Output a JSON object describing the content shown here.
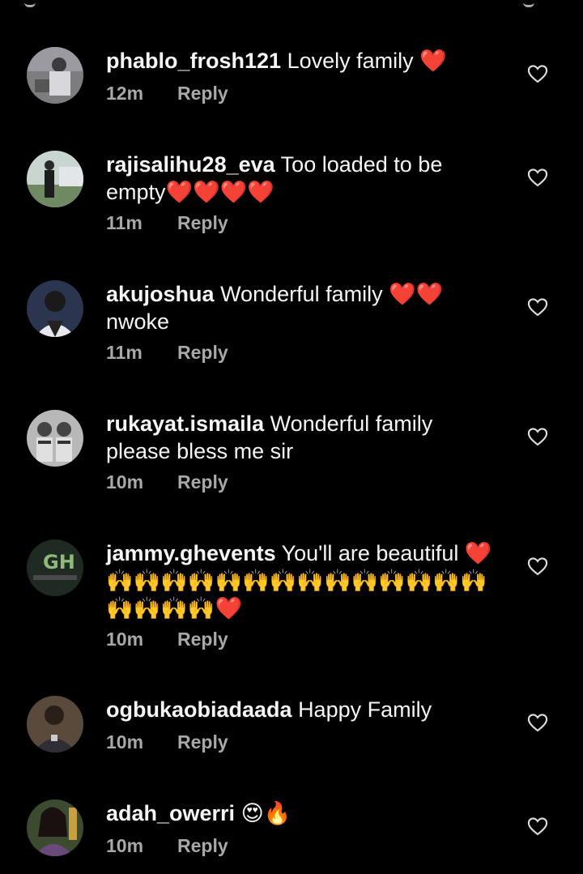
{
  "comments": [
    {
      "username": "phablo_frosh121",
      "text": "Lovely family ❤️",
      "time": "12m",
      "reply": "Reply"
    },
    {
      "username": "rajisalihu28_eva",
      "text": "Too loaded to be empty❤️❤️❤️❤️",
      "time": "11m",
      "reply": "Reply"
    },
    {
      "username": "akujoshua",
      "text": "Wonderful family ❤️❤️ nwoke",
      "time": "11m",
      "reply": "Reply"
    },
    {
      "username": "rukayat.ismaila",
      "text": "Wonderful family please bless me sir",
      "time": "10m",
      "reply": "Reply"
    },
    {
      "username": "jammy.ghevents",
      "text": "You'll are beautiful ❤️ 🙌🙌🙌🙌🙌🙌🙌🙌🙌🙌🙌🙌🙌🙌🙌🙌🙌🙌❤️",
      "time": "10m",
      "reply": "Reply"
    },
    {
      "username": "ogbukaobiadaada",
      "text": "Happy Family",
      "time": "10m",
      "reply": "Reply"
    },
    {
      "username": "adah_owerri",
      "text": "😍🔥",
      "time": "10m",
      "reply": "Reply"
    }
  ],
  "icons": {
    "like": "heart-outline-icon"
  },
  "colors": {
    "background": "#000000",
    "text": "#f5f5f5",
    "meta": "#a8a8a8"
  }
}
